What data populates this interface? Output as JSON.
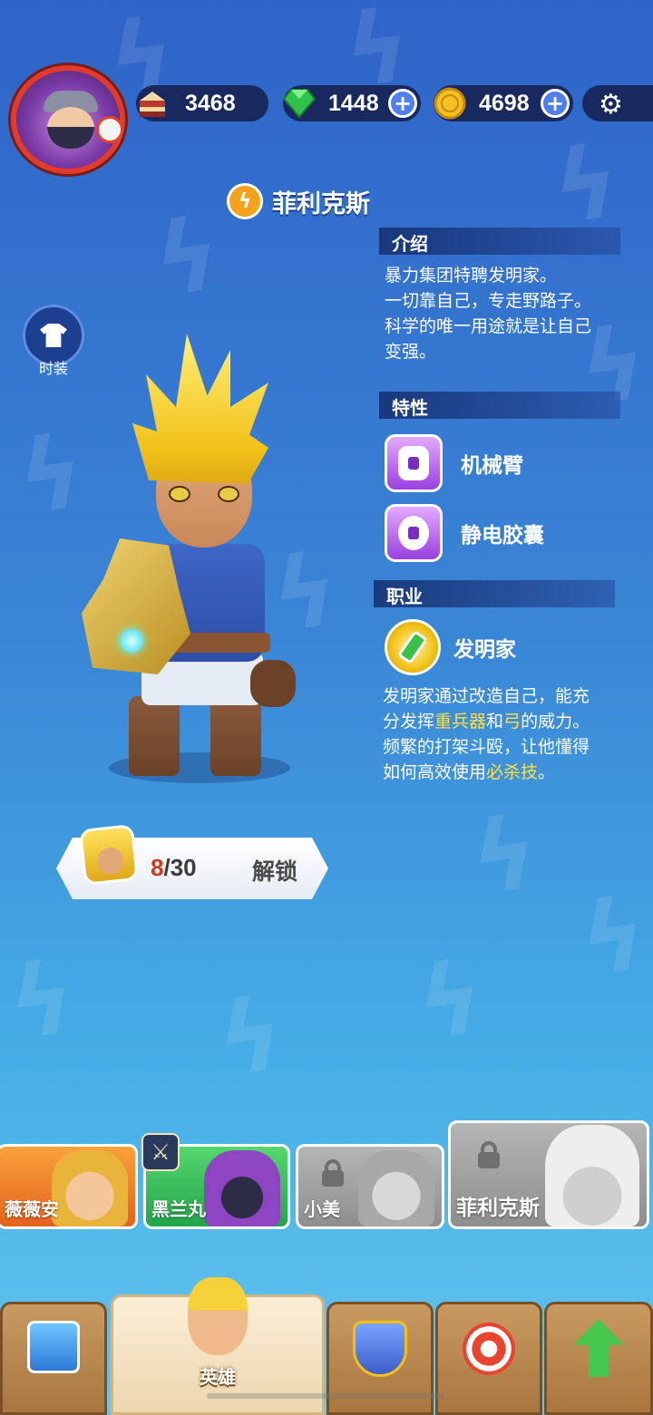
{
  "resources": {
    "cake": "3468",
    "gems": "1448",
    "coins": "4698"
  },
  "hero": {
    "name": "菲利克斯",
    "costume_label": "时装"
  },
  "intro": {
    "header": "介绍",
    "lines": [
      "暴力集团特聘发明家。",
      "一切靠自己，专走野路子。",
      "科学的唯一用途就是让自己",
      "变强。"
    ]
  },
  "traits": {
    "header": "特性",
    "items": [
      {
        "name": "机械臂"
      },
      {
        "name": "静电胶囊"
      }
    ]
  },
  "job": {
    "header": "职业",
    "name": "发明家",
    "desc": {
      "p1": "发明家通过改造自己，能充",
      "p2a": "分发挥",
      "p2b": "重兵器",
      "p2c": "和",
      "p2d": "弓",
      "p2e": "的威力。",
      "p3": "频繁的打架斗殴，让他懂得",
      "p4a": "如何高效使用",
      "p4b": "必杀技",
      "p4c": "。"
    }
  },
  "unlock": {
    "current": "8",
    "separator": "/30",
    "label": "解锁"
  },
  "hero_cards": [
    {
      "name": "薇薇安",
      "locked": false
    },
    {
      "name": "黑兰丸",
      "locked": false
    },
    {
      "name": "小美",
      "locked": true
    },
    {
      "name": "菲利克斯",
      "locked": true
    }
  ],
  "nav": {
    "active_label": "英雄"
  },
  "colors": {
    "highlight": "#ffe04a",
    "unlock_current": "#d6361c"
  }
}
